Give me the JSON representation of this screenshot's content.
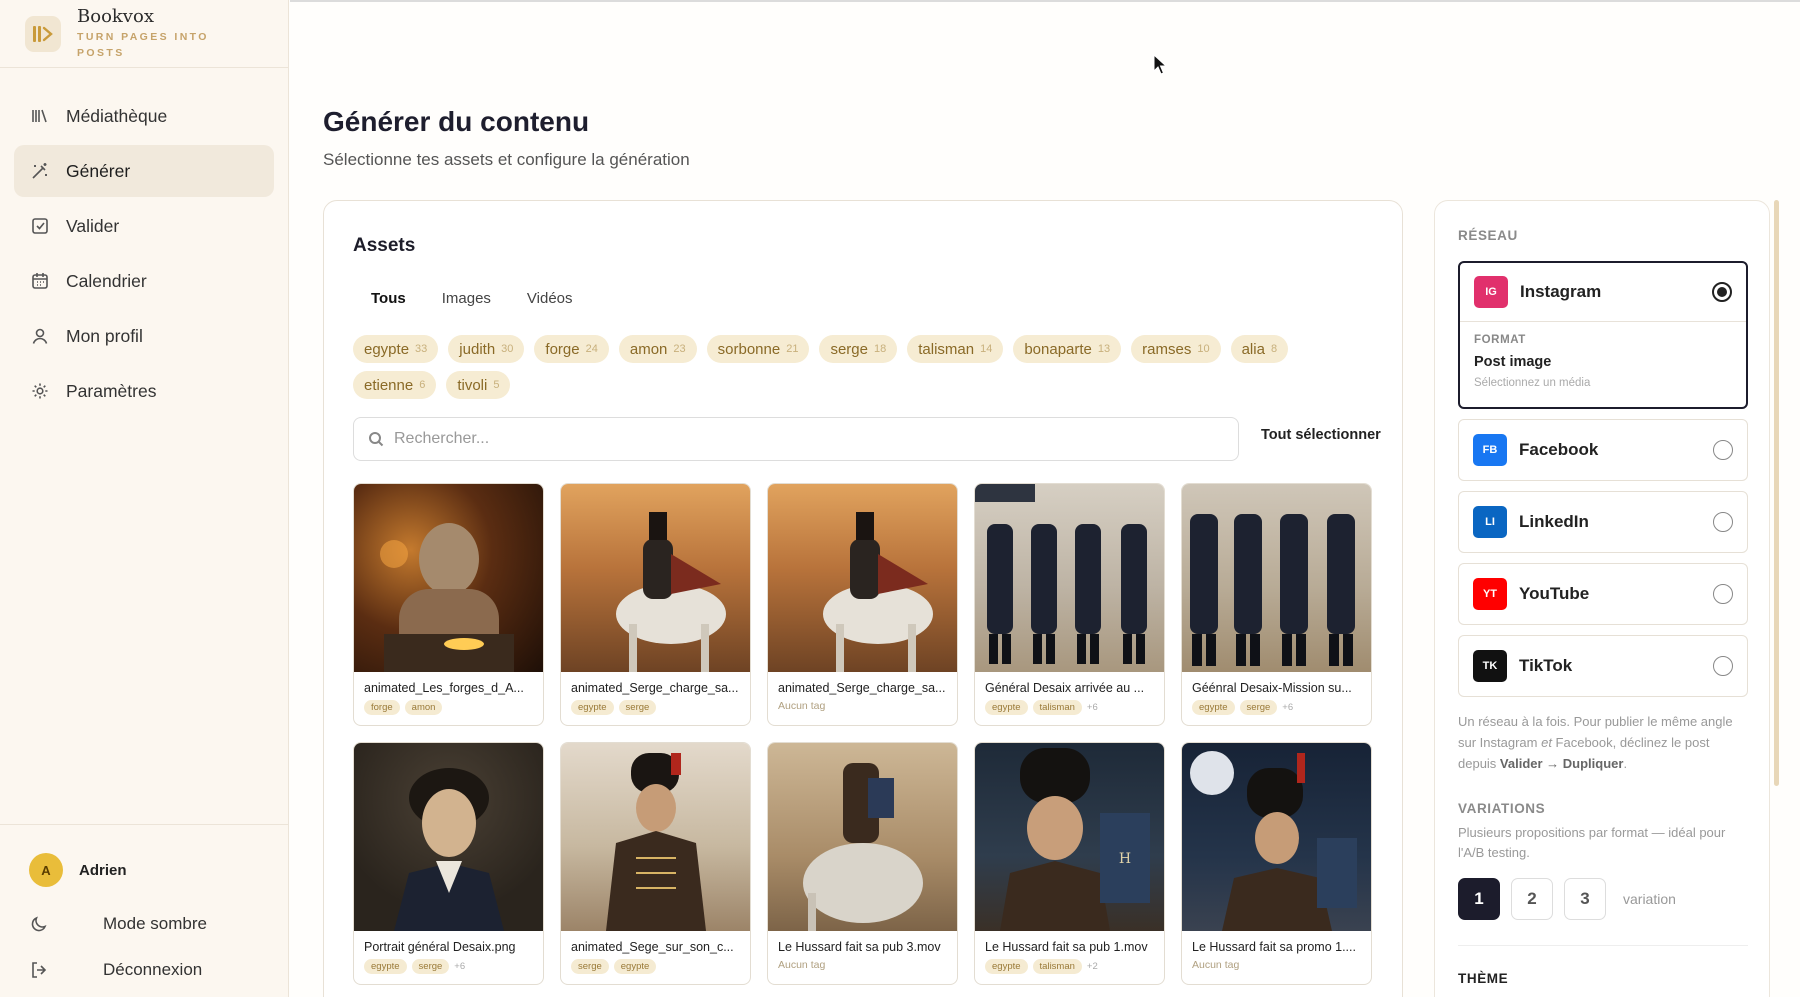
{
  "brand": {
    "name": "Bookvox",
    "tagline": "TURN PAGES INTO POSTS"
  },
  "sidebar": {
    "items": [
      {
        "label": "Médiathèque",
        "icon": "library-icon"
      },
      {
        "label": "Générer",
        "icon": "magic-wand-icon",
        "active": true
      },
      {
        "label": "Valider",
        "icon": "check-square-icon"
      },
      {
        "label": "Calendrier",
        "icon": "calendar-icon"
      },
      {
        "label": "Mon profil",
        "icon": "user-icon"
      },
      {
        "label": "Paramètres",
        "icon": "gear-icon"
      }
    ],
    "user": {
      "initial": "A",
      "name": "Adrien"
    },
    "dark_mode": "Mode sombre",
    "logout": "Déconnexion"
  },
  "main": {
    "title": "Générer du contenu",
    "subtitle": "Sélectionne tes assets et configure la génération"
  },
  "assets": {
    "title": "Assets",
    "tabs": [
      "Tous",
      "Images",
      "Vidéos"
    ],
    "active_tab": "Tous",
    "tags": [
      {
        "name": "egypte",
        "count": "33"
      },
      {
        "name": "judith",
        "count": "30"
      },
      {
        "name": "forge",
        "count": "24"
      },
      {
        "name": "amon",
        "count": "23"
      },
      {
        "name": "sorbonne",
        "count": "21"
      },
      {
        "name": "serge",
        "count": "18"
      },
      {
        "name": "talisman",
        "count": "14"
      },
      {
        "name": "bonaparte",
        "count": "13"
      },
      {
        "name": "ramses",
        "count": "10"
      },
      {
        "name": "alia",
        "count": "8"
      },
      {
        "name": "etienne",
        "count": "6"
      },
      {
        "name": "tivoli",
        "count": "5"
      }
    ],
    "search_placeholder": "Rechercher...",
    "select_all": "Tout sélectionner",
    "no_tag_label": "Aucun tag",
    "items": [
      {
        "name": "animated_Les_forges_d_A...",
        "tags": [
          "forge",
          "amon"
        ],
        "more": ""
      },
      {
        "name": "animated_Serge_charge_sa...",
        "tags": [
          "egypte",
          "serge"
        ],
        "more": ""
      },
      {
        "name": "animated_Serge_charge_sa...",
        "tags": [],
        "more": ""
      },
      {
        "name": "Général Desaix arrivée au ...",
        "tags": [
          "egypte",
          "talisman"
        ],
        "more": "+6"
      },
      {
        "name": "Géénral Desaix-Mission su...",
        "tags": [
          "egypte",
          "serge"
        ],
        "more": "+6"
      },
      {
        "name": "Portrait général Desaix.png",
        "tags": [
          "egypte",
          "serge"
        ],
        "more": "+6"
      },
      {
        "name": "animated_Sege_sur_son_c...",
        "tags": [
          "serge",
          "egypte"
        ],
        "more": ""
      },
      {
        "name": "Le Hussard fait sa pub 3.mov",
        "tags": [],
        "more": ""
      },
      {
        "name": "Le Hussard fait sa pub 1.mov",
        "tags": [
          "egypte",
          "talisman"
        ],
        "more": "+2"
      },
      {
        "name": "Le Hussard fait sa promo 1....",
        "tags": [],
        "more": ""
      }
    ]
  },
  "network": {
    "label": "RÉSEAU",
    "options": [
      {
        "abbr": "IG",
        "name": "Instagram",
        "color": "#e1306c",
        "selected": true
      },
      {
        "abbr": "FB",
        "name": "Facebook",
        "color": "#1877f2"
      },
      {
        "abbr": "LI",
        "name": "LinkedIn",
        "color": "#0a66c2"
      },
      {
        "abbr": "YT",
        "name": "YouTube",
        "color": "#ff0000"
      },
      {
        "abbr": "TK",
        "name": "TikTok",
        "color": "#111111"
      }
    ],
    "format_label": "FORMAT",
    "format_value": "Post image",
    "format_hint": "Sélectionnez un média",
    "help_start": "Un réseau à la fois. Pour publier le même angle sur Instagram ",
    "help_em": "et",
    "help_mid": " Facebook, déclinez le post depuis ",
    "help_bold": "Valider → Dupliquer",
    "help_end": "."
  },
  "variations": {
    "label": "VARIATIONS",
    "help": "Plusieurs propositions par format — idéal pour l'A/B testing.",
    "options": [
      "1",
      "2",
      "3"
    ],
    "selected": "1",
    "unit": "variation"
  },
  "theme": {
    "label": "THÈME"
  }
}
